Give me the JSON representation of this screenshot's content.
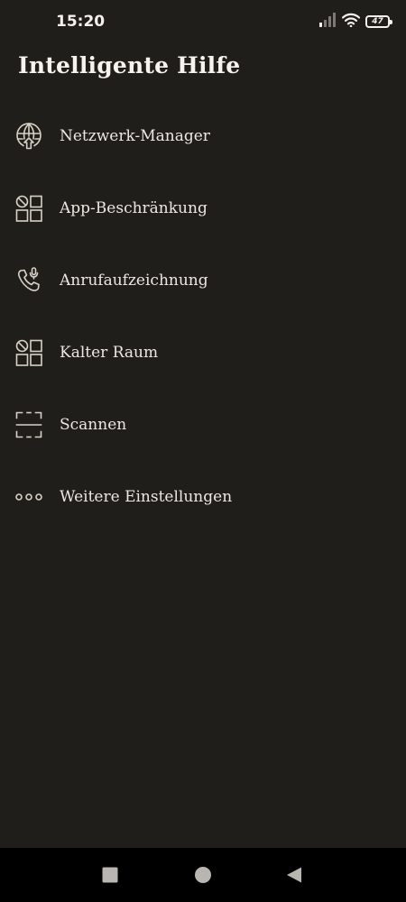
{
  "status_bar": {
    "time": "15:20",
    "battery_level": "47",
    "icons": [
      "signal-icon",
      "wifi-icon",
      "battery-icon"
    ]
  },
  "header": {
    "title": "Intelligente Hilfe"
  },
  "menu": {
    "items": [
      {
        "label": "Netzwerk-Manager",
        "icon": "globe-upload-icon"
      },
      {
        "label": "App-Beschränkung",
        "icon": "app-grid-block-icon"
      },
      {
        "label": "Anrufaufzeichnung",
        "icon": "phone-mic-icon"
      },
      {
        "label": "Kalter Raum",
        "icon": "app-grid-block-icon"
      },
      {
        "label": "Scannen",
        "icon": "scan-frame-icon"
      },
      {
        "label": "Weitere Einstellungen",
        "icon": "more-dots-icon"
      }
    ]
  },
  "nav_bar": {
    "buttons": [
      "recents-square-icon",
      "home-circle-icon",
      "back-triangle-icon"
    ]
  },
  "colors": {
    "background": "#201e1b",
    "text": "#ece7e0",
    "icon_stroke": "#d9d1c6",
    "nav_background": "#000000",
    "nav_icon": "#b9b5b0"
  }
}
